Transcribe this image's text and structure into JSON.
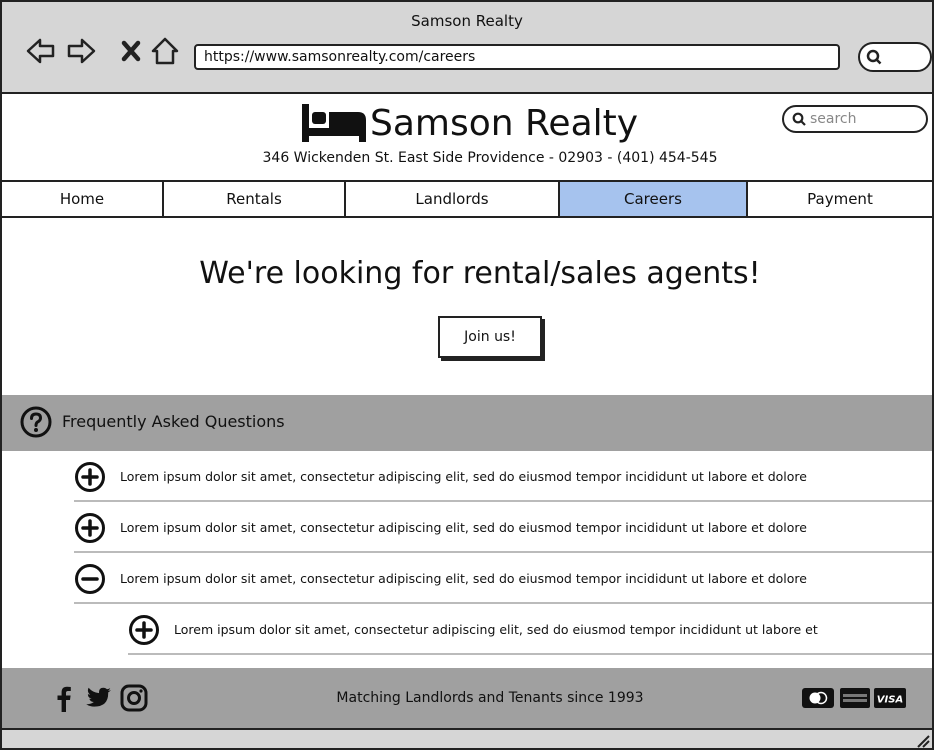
{
  "window": {
    "title": "Samson Realty"
  },
  "browser": {
    "url": "https://www.samsonrealty.com/careers",
    "icons": [
      "back-arrow-icon",
      "forward-arrow-icon",
      "close-x-icon",
      "home-icon",
      "search-icon"
    ]
  },
  "header": {
    "logo_icon": "bed-icon",
    "brand_name": "Samson Realty",
    "search_placeholder": "search",
    "address": "346 Wickenden St. East Side Providence - 02903 - (401) 454-545"
  },
  "nav": {
    "tabs": [
      {
        "label": "Home",
        "active": false
      },
      {
        "label": "Rentals",
        "active": false
      },
      {
        "label": "Landlords",
        "active": false
      },
      {
        "label": "Careers",
        "active": true
      },
      {
        "label": "Payment",
        "active": false
      }
    ],
    "active_color": "#a6c3ee"
  },
  "hero": {
    "title": "We're looking for rental/sales agents!",
    "button_label": "Join us!"
  },
  "faq": {
    "title": "Frequently Asked Questions",
    "icon": "question-circle-icon",
    "items": [
      {
        "text": "Lorem ipsum dolor sit amet, consectetur adipiscing elit, sed do eiusmod tempor incididunt ut labore et dolore",
        "state": "collapsed"
      },
      {
        "text": "Lorem ipsum dolor sit amet, consectetur adipiscing elit, sed do eiusmod tempor incididunt ut labore et dolore",
        "state": "collapsed"
      },
      {
        "text": "Lorem ipsum dolor sit amet, consectetur adipiscing elit, sed do eiusmod tempor incididunt ut labore et dolore",
        "state": "expanded"
      },
      {
        "text": "Lorem ipsum dolor sit amet, consectetur adipiscing elit, sed do eiusmod tempor incididunt ut labore et",
        "state": "collapsed"
      }
    ]
  },
  "footer": {
    "tagline": "Matching Landlords and Tenants since 1993",
    "social_icons": [
      "facebook-icon",
      "twitter-icon",
      "instagram-icon"
    ],
    "payment_icons": [
      "mastercard-icon",
      "amex-icon",
      "visa-icon"
    ],
    "visa_label": "VISA",
    "background": "#a0a0a0"
  }
}
